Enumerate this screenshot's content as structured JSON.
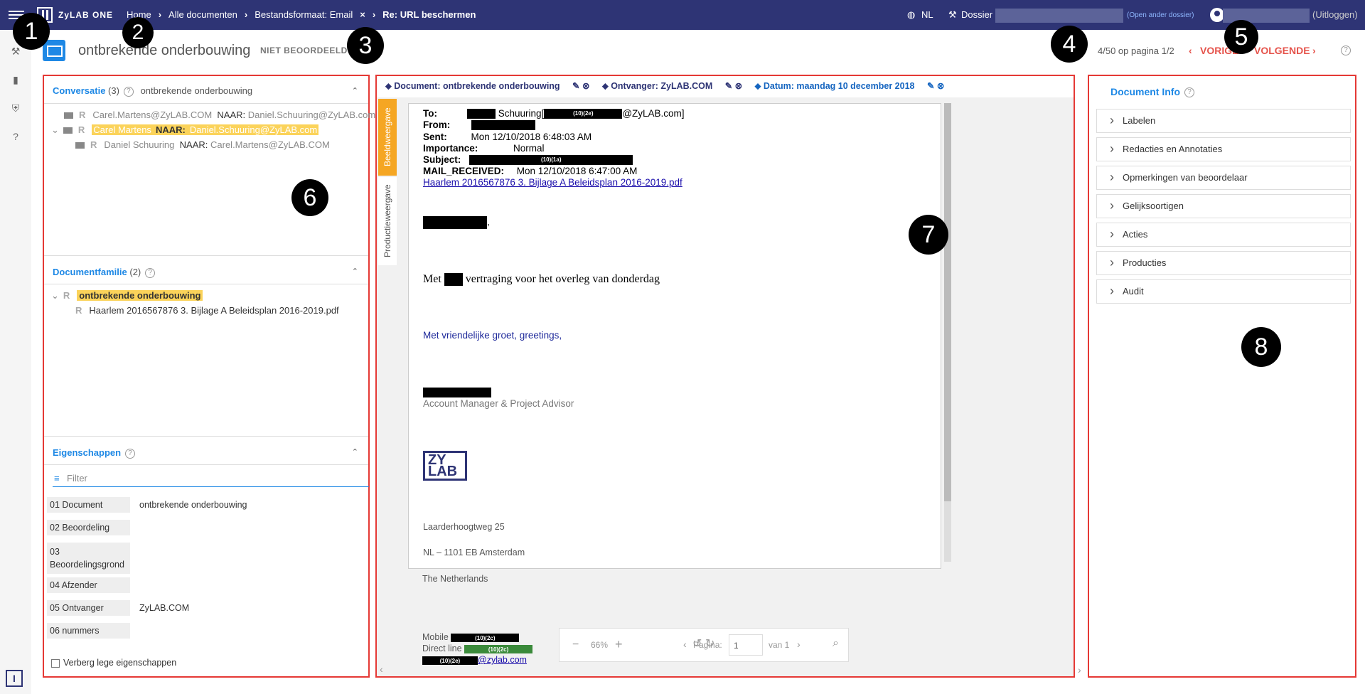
{
  "topbar": {
    "brand": "ZyLAB ONE",
    "breadcrumbs": [
      "Home",
      "Alle documenten",
      "Bestandsformaat: Email",
      "Re: URL beschermen"
    ],
    "language": "NL",
    "dossier_label": "Dossier",
    "open_other": "(Open ander dossier)",
    "logout": "(Uitloggen)"
  },
  "header": {
    "title": "ontbrekende onderbouwing",
    "status": "NIET BEOORDEELD",
    "pager": "4/50 op pagina 1/2",
    "prev": "VORIGE",
    "next": "VOLGENDE"
  },
  "markers": [
    "1",
    "2",
    "3",
    "4",
    "5",
    "6",
    "7",
    "8"
  ],
  "conversation": {
    "title": "Conversatie",
    "count": "(3)",
    "subject": "ontbrekende onderbouwing",
    "items": [
      {
        "from": "Carel.Martens@ZyLAB.COM",
        "naar": "NAAR:",
        "to": "Daniel.Schuuring@ZyLAB.com"
      },
      {
        "from": "Carel Martens",
        "naar": "NAAR:",
        "to": "Daniel.Schuuring@ZyLAB.com"
      },
      {
        "from": "Daniel Schuuring",
        "naar": "NAAR:",
        "to": "Carel.Martens@ZyLAB.COM"
      }
    ]
  },
  "family": {
    "title": "Documentfamilie",
    "count": "(2)",
    "items": [
      "ontbrekende onderbouwing",
      "Haarlem 2016567876 3. Bijlage A Beleidsplan 2016-2019.pdf"
    ]
  },
  "properties": {
    "title": "Eigenschappen",
    "filter_placeholder": "Filter",
    "rows": [
      {
        "k": "01 Document",
        "v": "ontbrekende onderbouwing"
      },
      {
        "k": "02 Beoordeling",
        "v": ""
      },
      {
        "k": "03 Beoordelingsgrond",
        "v": ""
      },
      {
        "k": "04 Afzender",
        "v": ""
      },
      {
        "k": "05 Ontvanger",
        "v": "ZyLAB.COM"
      },
      {
        "k": "06 nummers",
        "v": ""
      }
    ],
    "hide_empty": "Verberg lege eigenschappen"
  },
  "viewer": {
    "tags": [
      "Document: ontbrekende onderbouwing",
      "Ontvanger: ZyLAB.COM",
      "Datum: maandag 10 december 2018"
    ],
    "tabs": [
      "Beeldweergave",
      "Productieweergave"
    ],
    "email": {
      "to_label": "To:",
      "to_text": "Schuuring[",
      "to_code": "(10)(2e)",
      "to_domain": "@ZyLAB.com]",
      "from_label": "From:",
      "sent_label": "Sent:",
      "sent": "Mon 12/10/2018 6:48:03 AM",
      "importance_label": "Importance:",
      "importance": "Normal",
      "subject_label": "Subject:",
      "subject_code": "(10)(1a)",
      "received_label": "MAIL_RECEIVED:",
      "received": "Mon 12/10/2018 6:47:00 AM",
      "attachment": "Haarlem 2016567876 3. Bijlage A Beleidsplan 2016-2019.pdf",
      "body_pre": "Met",
      "body_post": "vertraging voor het overleg van donderdag",
      "greeting": "Met vriendelijke groet, greetings,",
      "role": "Account Manager & Project Advisor",
      "address1": "Laarderhoogtweg 25",
      "address2": "NL – 1101 EB  Amsterdam",
      "address3": "The Netherlands",
      "mobile_label": "Mobile",
      "direct_label": "Direct line",
      "code_2e": "(10)(2e)",
      "code_2c": "(10)(2c)",
      "mail_domain": "@zylab.com"
    },
    "zoom": "66%",
    "page_label": "Pagina:",
    "page_value": "1",
    "page_of": "van 1"
  },
  "docinfo": {
    "title": "Document Info",
    "sections": [
      "Labelen",
      "Redacties en Annotaties",
      "Opmerkingen van beoordelaar",
      "Gelijksoortigen",
      "Acties",
      "Producties",
      "Audit"
    ]
  }
}
